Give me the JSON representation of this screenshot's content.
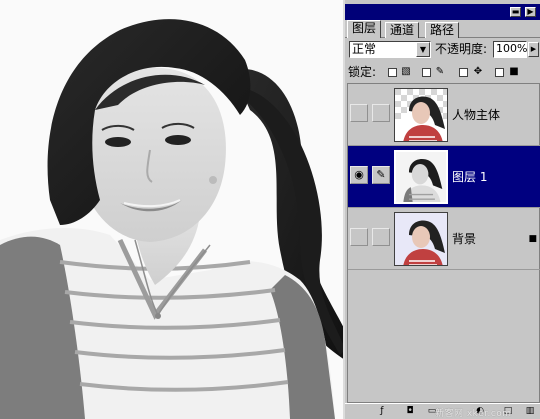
{
  "palette": {
    "tabs": [
      {
        "label": "图层"
      },
      {
        "label": "通道"
      },
      {
        "label": "路径"
      }
    ],
    "titlebar_buttons": {
      "minimize": "▬",
      "close": "▶"
    },
    "blend_mode": {
      "value": "正常"
    },
    "opacity": {
      "label": "不透明度:",
      "value": "100%"
    },
    "lock": {
      "label": "锁定:"
    },
    "layers": [
      {
        "name": "人物主体",
        "visible": false,
        "selected": false,
        "locked": false
      },
      {
        "name": "图层 1",
        "visible": true,
        "selected": true,
        "locked": false
      },
      {
        "name": "背景",
        "visible": false,
        "selected": false,
        "locked": true
      }
    ],
    "watermark": "新客网 xker.com"
  },
  "icons": {
    "eye": "eye-icon",
    "brush": "brush-icon",
    "lock": "padlock-icon"
  },
  "colors": {
    "titlebar": "#000078",
    "selected_layer": "#000080",
    "panel": "#c6c6c6"
  }
}
